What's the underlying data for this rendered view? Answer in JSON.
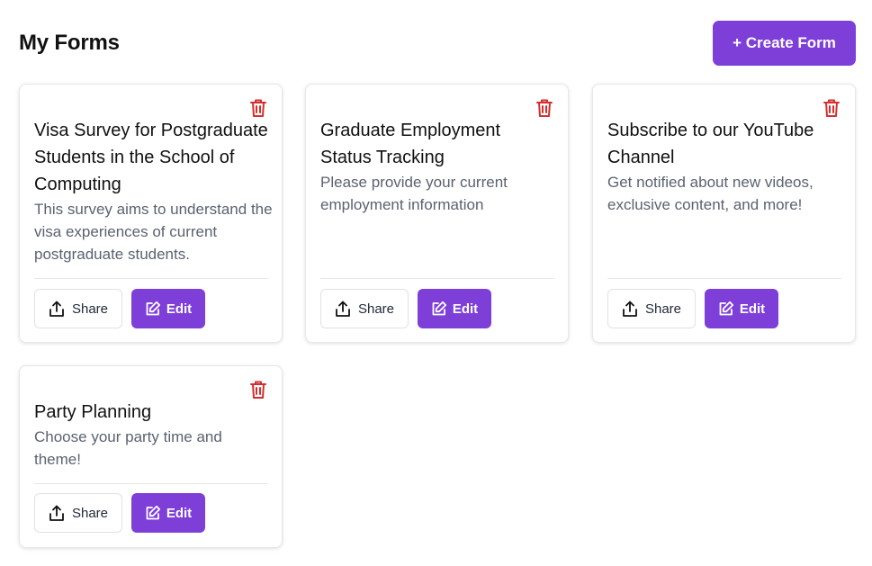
{
  "header": {
    "title": "My Forms",
    "create_label": "+ Create Form"
  },
  "colors": {
    "accent": "#7e3fd9",
    "delete": "#d32f2f"
  },
  "icons": {
    "delete": "trash-icon",
    "share": "share-icon",
    "edit": "edit-icon"
  },
  "forms": [
    {
      "title": "Visa Survey for Postgraduate Students in the School of Computing",
      "description": "This survey aims to understand the visa experiences of current postgraduate students.",
      "share_label": "Share",
      "edit_label": "Edit"
    },
    {
      "title": "Graduate Employment Status Tracking",
      "description": "Please provide your current employment information",
      "share_label": "Share",
      "edit_label": "Edit"
    },
    {
      "title": "Subscribe to our YouTube Channel",
      "description": "Get notified about new videos, exclusive content, and more!",
      "share_label": "Share",
      "edit_label": "Edit"
    },
    {
      "title": "Party Planning",
      "description": "Choose your party time and theme!",
      "share_label": "Share",
      "edit_label": "Edit"
    }
  ]
}
